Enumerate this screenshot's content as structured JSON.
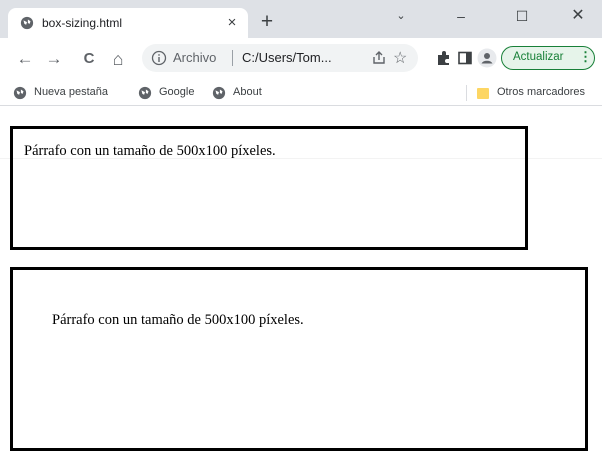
{
  "tab": {
    "title": "box-sizing.html",
    "close_glyph": "×",
    "favicon_icon": "globe-icon"
  },
  "new_tab_glyph": "+",
  "window_controls": {
    "search_tabs": "⌄",
    "minimize": "–",
    "maximize": "☐",
    "close": "✕"
  },
  "toolbar": {
    "back": "←",
    "forward": "→",
    "reload": "C",
    "home": "⌂",
    "address": {
      "chip": "Archivo",
      "url": "C:/Users/Tom...",
      "star": "☆"
    },
    "update_label": "Actualizar",
    "update_menu": "⋮"
  },
  "bookmarks": {
    "items": [
      {
        "label": "Nueva pestaña",
        "icon": "globe-icon"
      },
      {
        "label": "Google",
        "icon": "globe-icon"
      },
      {
        "label": "About",
        "icon": "globe-icon"
      }
    ],
    "other": "Otros marcadores"
  },
  "page": {
    "para1": "Párrafo con un tamaño de 500x100 píxeles.",
    "para2": "Párrafo con un tamaño de 500x100 píxeles."
  },
  "colors": {
    "tabstrip": "#dee1e6",
    "update_accent": "#188038",
    "folder": "#fdd663"
  }
}
